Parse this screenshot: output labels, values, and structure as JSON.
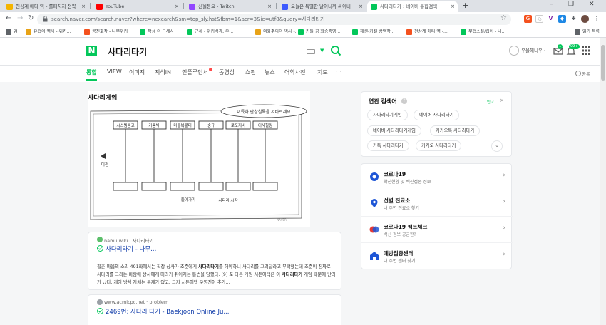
{
  "browser": {
    "tabs": [
      {
        "title": "천상계 메타 역 - 롤패치지 전략",
        "color": "#f4b400"
      },
      {
        "title": "YouTube",
        "color": "#ff0000"
      },
      {
        "title": "신월동요 - Twitch",
        "color": "#9146ff"
      },
      {
        "title": "오늘은 특별한 날이니까 싸이비",
        "color": "#3d5afe"
      },
      {
        "title": "사다리타기 : 네이버 통합검색",
        "color": "#03c75a"
      }
    ],
    "new_tab": "+",
    "url": "search.naver.com/search.naver?where=nexearch&sm=top_sly.hst&fbm=1&acr=3&ie=utf8&query=사다리타기",
    "bookmarks": [
      {
        "label": "앱",
        "color": "#5f6368"
      },
      {
        "label": "유럽의 역사 - 위키...",
        "color": "#e8a317"
      },
      {
        "label": "콩진호착 - 나무위키",
        "color": "#f4511e"
      },
      {
        "label": "작성 의 근세사",
        "color": "#03c75a"
      },
      {
        "label": "근세 - 위키백과, 우...",
        "color": "#03c75a"
      },
      {
        "label": "외화주의의 역사 -...",
        "color": "#e8a317"
      },
      {
        "label": "카톨 꿈 화송층엠...",
        "color": "#03c75a"
      },
      {
        "label": "해센-카셀 방백작...",
        "color": "#03c75a"
      },
      {
        "label": "천상계 메타 역 -...",
        "color": "#f4511e"
      },
      {
        "label": "무협소설/웹어 - 나...",
        "color": "#03c75a"
      }
    ],
    "other_bookmarks": "읽기 목록"
  },
  "naver": {
    "logo": "N",
    "query": "사다리타기",
    "user": "우울해니우 ·",
    "badge_mail": "1",
    "badge_notice": "99+",
    "tabs": [
      "통합",
      "VIEW",
      "이미지",
      "지식iN",
      "인플루언서",
      "동영상",
      "쇼핑",
      "뉴스",
      "어학사전",
      "지도",
      "· · ·"
    ],
    "share": "공유"
  },
  "image_card": {
    "title": "사다리게임",
    "sketch_labels": [
      "시스템숨고",
      "가롱빅",
      "마블복불대",
      "숭규",
      "로포지버",
      "어사힐링"
    ],
    "bubble": "이륙하 판찰칠록을 저바르세요",
    "left_label": "이전",
    "bottom_left": "돌아가기",
    "bottom_right": "사다리 시작",
    "watermark": "NAVER"
  },
  "results": [
    {
      "source": "namu.wiki · 사다리타기",
      "title": "사다리타기 - 나무...",
      "desc_1": "필촌 마음의 소리 491화에서는 직장 상사가 조준에게",
      "desc_bold": "사다리타기",
      "desc_2": "를 해야하니 사다리를 그려달라고 부탁했는데 조준이 진짜로 사다리를 그리는 바람에 상사에게 머리가 쥐어지는 통변을 당했다.",
      "desc_3": "[9] 포 다른 게임 서든어택은 이",
      "desc_bold2": "사다리타기",
      "desc_4": "게임 때문에 난리가 났다. 게임 방식 자체는 문제가 없고, 그저 서든어택 운영진이 추가..."
    },
    {
      "source": "www.acmicpc.net · problem",
      "title": "2469번: 사다리 타기 - Baekjoon Online Ju..."
    }
  ],
  "related": {
    "title": "연관 검색어",
    "info": "?",
    "mini": "입고",
    "close": "×",
    "chips": [
      "사다리타기게임",
      "네이버 사다리타기",
      "네이버 사다리타기게임",
      "카카오톡 사다리타기",
      "카톡 사다리타기",
      "카카오 사다리타기"
    ],
    "more": "⌄"
  },
  "info_list": [
    {
      "title": "코로나19",
      "sub": "확진현황 및 백신접종 정보",
      "color": "#1e56d6"
    },
    {
      "title": "선별 진료소",
      "sub": "내 주변 진료소 찾기",
      "color": "#1e56d6"
    },
    {
      "title": "코로나19 팩트체크",
      "sub": "백신 정보 궁금한?",
      "color": "#e53935"
    },
    {
      "title": "예방접종센터",
      "sub": "내 주변 센터 찾기",
      "color": "#1e56d6"
    }
  ]
}
